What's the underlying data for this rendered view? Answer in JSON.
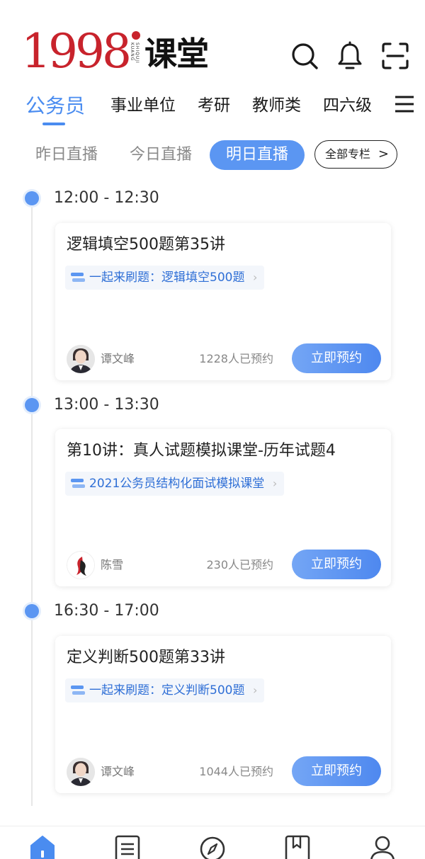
{
  "app": {
    "logo_number": "1998",
    "logo_small_text": "SHIQUJI KUANG",
    "logo_text": "课堂"
  },
  "header_icons": [
    "search-icon",
    "bell-icon",
    "scan-icon"
  ],
  "category_tabs": [
    {
      "label": "公务员",
      "active": true
    },
    {
      "label": "事业单位",
      "active": false
    },
    {
      "label": "考研",
      "active": false
    },
    {
      "label": "教师类",
      "active": false
    },
    {
      "label": "四六级",
      "active": false
    }
  ],
  "day_tabs": [
    {
      "label": "昨日直播",
      "active": false
    },
    {
      "label": "今日直播",
      "active": false
    },
    {
      "label": "明日直播",
      "active": true
    }
  ],
  "all_columns_label": "全部专栏",
  "all_columns_chevron": ">",
  "colors": {
    "accent": "#4a8cf0",
    "button": "#5b96f2",
    "logo_red": "#c8232c"
  },
  "sessions": [
    {
      "time": "12:00 - 12:30",
      "title": "逻辑填空500题第35讲",
      "series": "一起来刷题：逻辑填空500题",
      "teacher": "谭文峰",
      "reserved": "1228人已预约",
      "button": "立即预约",
      "avatar_type": "person"
    },
    {
      "time": "13:00 - 13:30",
      "title": "第10讲：真人试题模拟课堂-历年试题4",
      "series": "2021公务员结构化面试模拟课堂",
      "teacher": "陈雪",
      "reserved": "230人已预约",
      "button": "立即预约",
      "avatar_type": "logo"
    },
    {
      "time": "16:30 - 17:00",
      "title": "定义判断500题第33讲",
      "series": "一起来刷题：定义判断500题",
      "teacher": "谭文峰",
      "reserved": "1044人已预约",
      "button": "立即预约",
      "avatar_type": "person"
    }
  ],
  "bottom_nav": [
    {
      "icon": "home-icon",
      "active": true
    },
    {
      "icon": "list-icon",
      "active": false
    },
    {
      "icon": "compass-icon",
      "active": false
    },
    {
      "icon": "bookmark-icon",
      "active": false
    },
    {
      "icon": "profile-icon",
      "active": false
    }
  ]
}
